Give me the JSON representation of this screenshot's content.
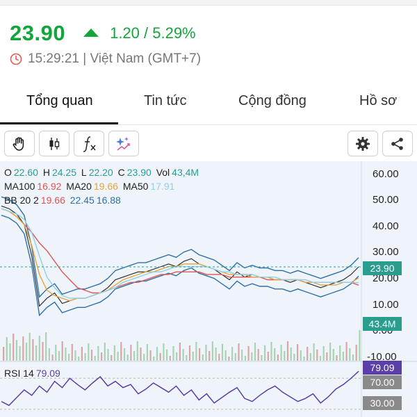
{
  "quote": {
    "price": "23.90",
    "change": "1.20 / 5.29%",
    "time": "15:29:21 | Việt Nam (GMT+7)"
  },
  "tabs": [
    {
      "label": "Tổng quan",
      "active": true
    },
    {
      "label": "Tin tức",
      "active": false
    },
    {
      "label": "Cộng đồng",
      "active": false
    },
    {
      "label": "Hồ sơ",
      "active": false
    }
  ],
  "toolbar": {
    "left": [
      "hand-tool-icon",
      "candlestick-icon",
      "indicator-fx-icon",
      "ai-sparkle-icon"
    ],
    "right": [
      "settings-gear-icon",
      "share-icon"
    ]
  },
  "ohlc": {
    "o_label": "O",
    "o": "22.60",
    "h_label": "H",
    "h": "24.25",
    "l_label": "L",
    "l": "22.20",
    "c_label": "C",
    "c": "23.90",
    "vol_label": "Vol",
    "vol": "43,4M"
  },
  "ma": {
    "ma100_label": "MA100",
    "ma100": "16.92",
    "ma20_label": "MA20",
    "ma20": "19.66",
    "ma50_label": "MA50",
    "ma50": "17.91"
  },
  "bb": {
    "label": "BB 20 2",
    "mid": "19.66",
    "upper": "22.45",
    "lower": "16.88"
  },
  "rsi": {
    "label": "RSI 14",
    "value": "79.09"
  },
  "price_axis": [
    "60.00",
    "50.00",
    "40.00",
    "30.00",
    "20.00",
    "10.00",
    "0.00",
    "-10.00"
  ],
  "tags": {
    "price": "23.90",
    "volume": "43.4M",
    "rsi": "79.09",
    "rsi_upper": "70.00",
    "rsi_lower": "30.00"
  },
  "colors": {
    "up": "#12a53c",
    "price_tag": "#2a9d8f",
    "ma_red": "#e05353",
    "ma_orange": "#e6a33c",
    "ma_lightblue": "#8fd0e6",
    "bb_blue": "#2e6fa8",
    "rsi_purple": "#5b3fa8"
  },
  "chart_data": {
    "type": "line",
    "series": [
      {
        "name": "Price",
        "values": [
          47,
          46,
          44,
          40,
          28,
          9,
          12,
          14,
          10,
          11,
          12,
          12,
          13,
          14,
          16,
          19,
          20,
          21,
          22,
          22,
          23,
          24,
          25,
          24,
          26,
          27,
          25,
          24,
          23,
          21,
          19,
          22,
          20,
          21,
          20,
          20,
          19,
          19,
          18,
          19,
          18,
          17,
          16,
          17,
          18,
          19,
          21,
          23.9
        ]
      },
      {
        "name": "MA100",
        "values": [
          46,
          45,
          43,
          40,
          37,
          33,
          30,
          26,
          22,
          19,
          16,
          15,
          14,
          14,
          15,
          16,
          17,
          18,
          18,
          19,
          20,
          21,
          21,
          22,
          22,
          22,
          22,
          21,
          21,
          21,
          20,
          20,
          20,
          20,
          20,
          19,
          19,
          19,
          19,
          19,
          18,
          18,
          18,
          18,
          18,
          18,
          18,
          16.92
        ]
      },
      {
        "name": "MA20",
        "values": [
          46,
          45,
          43,
          40,
          32,
          21,
          15,
          13,
          12,
          11,
          12,
          12,
          13,
          14,
          15,
          17,
          19,
          20,
          21,
          22,
          22,
          23,
          24,
          24,
          25,
          25,
          25,
          24,
          23,
          22,
          21,
          21,
          21,
          20,
          20,
          20,
          19,
          19,
          19,
          19,
          18,
          18,
          17,
          17,
          17,
          18,
          18,
          19.66
        ]
      },
      {
        "name": "MA50",
        "values": [
          46,
          45,
          44,
          42,
          37,
          28,
          20,
          16,
          13,
          12,
          12,
          12,
          13,
          14,
          15,
          16,
          18,
          19,
          20,
          21,
          22,
          22,
          23,
          24,
          24,
          24,
          24,
          24,
          23,
          22,
          22,
          21,
          21,
          21,
          20,
          20,
          20,
          19,
          19,
          19,
          19,
          18,
          18,
          18,
          18,
          18,
          18,
          17.91
        ]
      }
    ],
    "ylim": [
      -12,
      64
    ],
    "rsi_values": [
      40,
      35,
      45,
      55,
      48,
      60,
      52,
      66,
      58,
      70,
      62,
      55,
      64,
      72,
      60,
      66,
      58,
      62,
      50,
      56,
      64,
      58,
      52,
      60,
      48,
      55,
      42,
      50,
      38,
      45,
      52,
      58,
      44,
      40,
      48,
      55,
      60,
      52,
      46,
      40,
      44,
      50,
      38,
      46,
      56,
      62,
      70,
      79.09
    ],
    "rsi_ylim": [
      20,
      90
    ]
  }
}
